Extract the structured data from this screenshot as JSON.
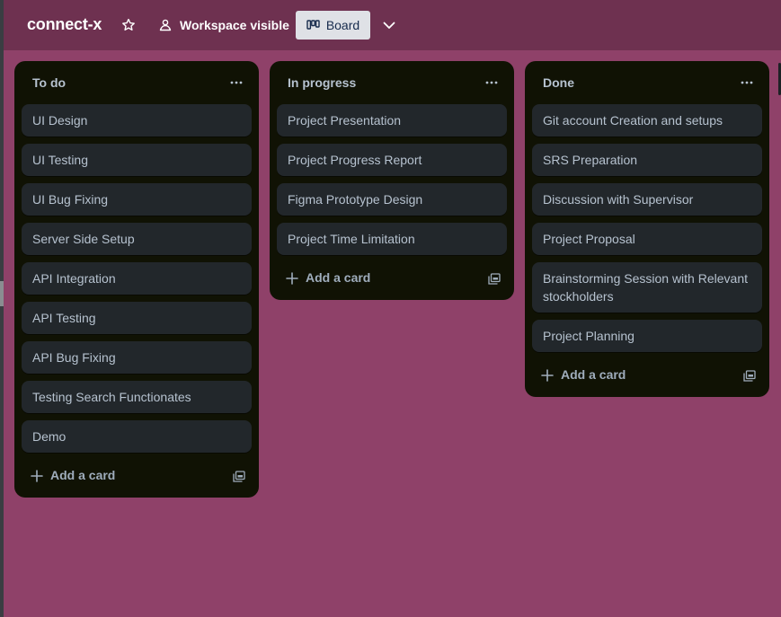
{
  "board": {
    "title": "connect-x",
    "visibility_label": "Workspace visible",
    "view_label": "Board",
    "background_color": "#8f4169",
    "header_color": "#6e3150"
  },
  "lists": [
    {
      "title": "To do",
      "cards": [
        "UI Design",
        "UI Testing",
        "UI Bug Fixing",
        "Server Side Setup",
        "API Integration",
        "API Testing",
        "API Bug Fixing",
        "Testing Search Functionates",
        "Demo"
      ],
      "add_label": "Add a card"
    },
    {
      "title": "In progress",
      "cards": [
        "Project Presentation",
        "Project Progress Report",
        "Figma Prototype Design",
        "Project Time Limitation"
      ],
      "add_label": "Add a card"
    },
    {
      "title": "Done",
      "cards": [
        "Git account Creation and setups",
        "SRS Preparation",
        "Discussion with Supervisor",
        "Project Proposal",
        "Brainstorming Session with Relevant stockholders",
        "Project Planning"
      ],
      "add_label": "Add a card"
    }
  ],
  "icons": {
    "star": "star-icon",
    "visibility": "workspace-visibility-icon",
    "board_view": "board-view-icon",
    "chevron": "chevron-down-icon",
    "list_menu": "more-horizontal-icon",
    "add": "plus-icon",
    "template": "card-template-icon"
  }
}
